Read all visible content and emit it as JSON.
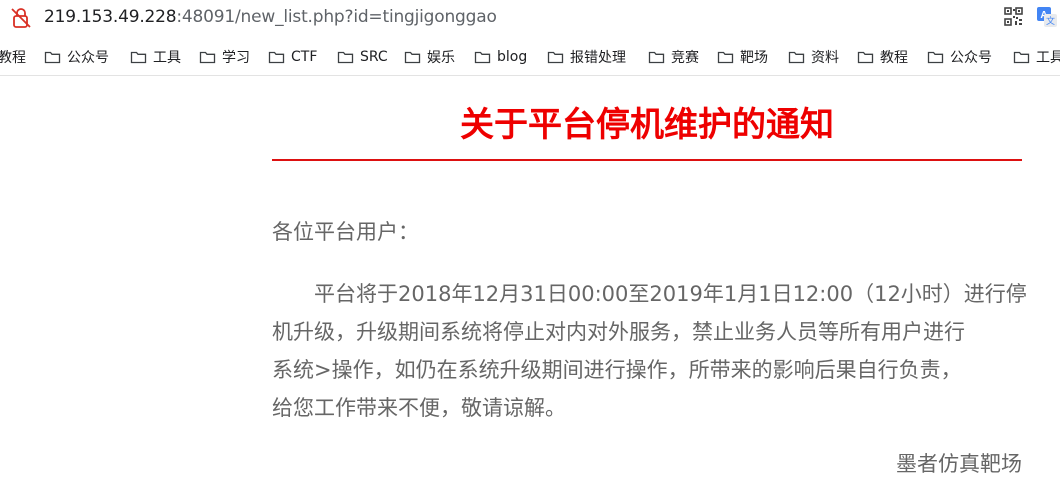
{
  "address_bar": {
    "url_host": "219.153.49.228",
    "url_rest": ":48091/new_list.php?id=tingjigonggao",
    "security_icon": "not-secure-lock-icon",
    "qr_icon": "qr-code-icon",
    "translate_icon": "translate-icon"
  },
  "bookmarks": [
    {
      "label": "教程",
      "folder": false
    },
    {
      "label": "公众号",
      "folder": true
    },
    {
      "label": "工具",
      "folder": true
    },
    {
      "label": "学习",
      "folder": true
    },
    {
      "label": "CTF",
      "folder": true
    },
    {
      "label": "SRC",
      "folder": true
    },
    {
      "label": "娱乐",
      "folder": true
    },
    {
      "label": "blog",
      "folder": true
    },
    {
      "label": "报错处理",
      "folder": true
    },
    {
      "label": "竞赛",
      "folder": true
    },
    {
      "label": "靶场",
      "folder": true
    },
    {
      "label": "资料",
      "folder": true
    },
    {
      "label": "教程",
      "folder": true
    },
    {
      "label": "公众号",
      "folder": true
    },
    {
      "label": "工具",
      "folder": true
    }
  ],
  "notice": {
    "title": "关于平台停机维护的通知",
    "greeting": "各位平台用户：",
    "body_lines": [
      "　　平台将于2018年12月31日00:00至2019年1月1日12:00（12小时）进行停",
      "机升级，升级期间系统将停止对内对外服务，禁止业务人员等所有用户进行",
      "系统>操作，如仍在系统升级期间进行操作，所带来的影响后果自行负责，",
      "给您工作带来不便，敬请谅解。"
    ],
    "signature": "墨者仿真靶场"
  },
  "colors": {
    "title": "#ee0000",
    "rule": "#dd1111",
    "body_text": "#666666",
    "url_host": "#202124",
    "url_rest": "#5f6368"
  }
}
